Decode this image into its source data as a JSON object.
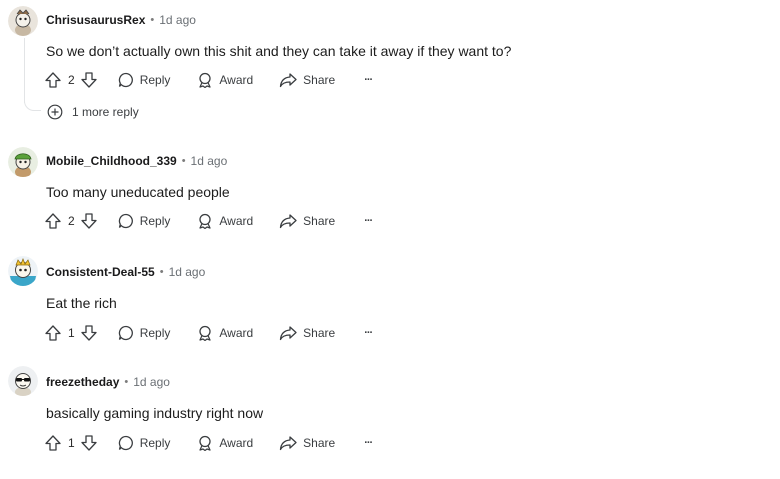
{
  "comments": [
    {
      "author": "ChrisusaurusRex",
      "separator": "•",
      "time": "1d ago",
      "text": "So we don’t actually own this shit and they can take it away if they want to?",
      "votes": "2",
      "reply_label": "Reply",
      "award_label": "Award",
      "share_label": "Share",
      "more_label": "···",
      "more_replies": "1 more reply"
    },
    {
      "author": "Mobile_Childhood_339",
      "separator": "•",
      "time": "1d ago",
      "text": "Too many uneducated people",
      "votes": "2",
      "reply_label": "Reply",
      "award_label": "Award",
      "share_label": "Share",
      "more_label": "···"
    },
    {
      "author": "Consistent-Deal-55",
      "separator": "•",
      "time": "1d ago",
      "text": "Eat the rich",
      "votes": "1",
      "reply_label": "Reply",
      "award_label": "Award",
      "share_label": "Share",
      "more_label": "···"
    },
    {
      "author": "freezetheday",
      "separator": "•",
      "time": "1d ago",
      "text": "basically gaming industry right now",
      "votes": "1",
      "reply_label": "Reply",
      "award_label": "Award",
      "share_label": "Share",
      "more_label": "···"
    }
  ],
  "icons": {
    "upvote": "upvote-icon",
    "downvote": "downvote-icon",
    "reply": "comment-bubble-icon",
    "award": "award-icon",
    "share": "share-icon",
    "more": "more-options-icon",
    "expand": "plus-circle-icon"
  },
  "colors": {
    "text": "#1c1c1c",
    "muted": "#6a6f74",
    "thread": "#e2e4e6"
  }
}
